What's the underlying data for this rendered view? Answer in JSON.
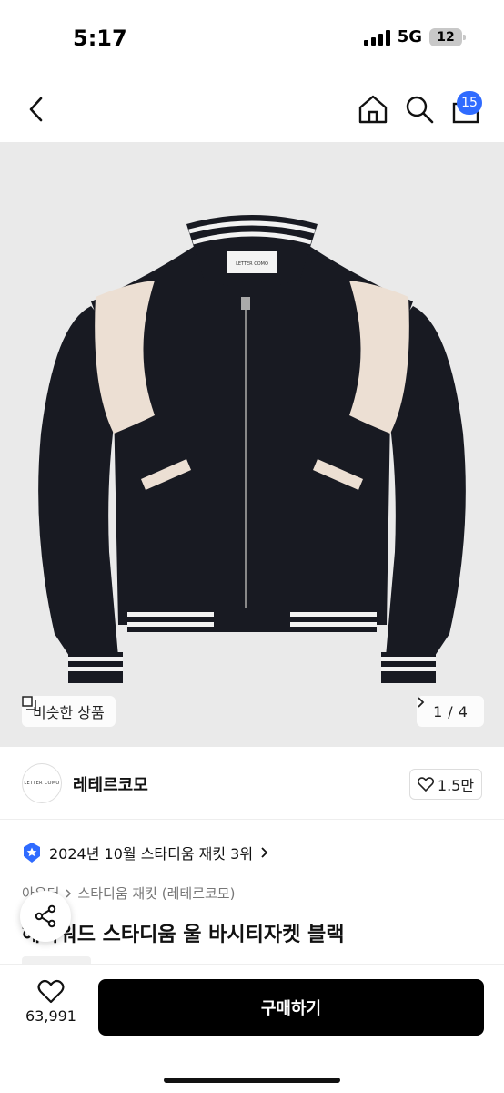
{
  "status_bar": {
    "time": "5:17",
    "network": "5G",
    "battery": "12"
  },
  "nav": {
    "cart_badge": "15"
  },
  "image": {
    "similar_label": "비슷한 상품",
    "page_current": "1",
    "page_sep": "/",
    "page_total": "4",
    "brand_tag": "LETTER COMO"
  },
  "brand": {
    "logo_text": "LETTER COMO",
    "name": "레테르코모",
    "likes": "1.5만"
  },
  "ranking": {
    "text": "2024년 10월 스타디움 재킷 3위"
  },
  "breadcrumb": {
    "category": "아우터",
    "subcategory": "스타디움 재킷 (레테르코모)"
  },
  "product": {
    "title": "헤비워드 스타디움 울 바시티자켓 블랙"
  },
  "bottom": {
    "wish_count": "63,991",
    "buy_label": "구매하기"
  },
  "colors": {
    "accent": "#2f6bff",
    "buy_bg": "#000000",
    "image_bg": "#eaeaea",
    "jacket": "#181a22",
    "panel": "#ecdfd3"
  },
  "icons": [
    "back-icon",
    "home-icon",
    "search-icon",
    "cart-icon",
    "similar-icon",
    "chevron-right-icon",
    "heart-icon",
    "medal-icon",
    "share-icon"
  ]
}
